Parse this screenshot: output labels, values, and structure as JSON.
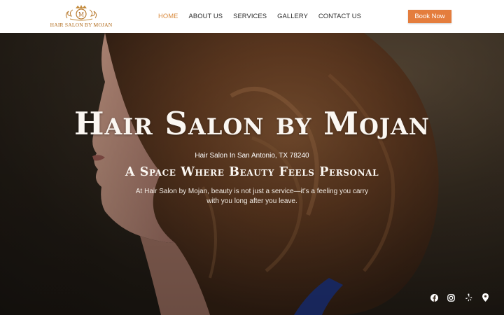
{
  "header": {
    "logo_text": "HAIR SALON BY MOJAN",
    "logo_monogram": "M",
    "nav": [
      {
        "label": "HOME",
        "active": true
      },
      {
        "label": "ABOUT US",
        "active": false
      },
      {
        "label": "SERVICES",
        "active": false
      },
      {
        "label": "GALLERY",
        "active": false
      },
      {
        "label": "CONTACT US",
        "active": false
      }
    ],
    "book_label": "Book Now"
  },
  "hero": {
    "title": "Hair Salon by Mojan",
    "location": "Hair Salon In San Antonio, TX 78240",
    "tagline": "A Space Where Beauty Feels Personal",
    "description": "At Hair Salon by Mojan, beauty is not just a service—it’s a feeling you carry with you long after you leave."
  },
  "social": [
    {
      "icon": "facebook-icon"
    },
    {
      "icon": "instagram-icon"
    },
    {
      "icon": "yelp-icon"
    },
    {
      "icon": "map-pin-icon"
    }
  ],
  "colors": {
    "accent": "#e47d3d",
    "nav_active": "#d98a3d",
    "logo": "#b06a1a"
  }
}
